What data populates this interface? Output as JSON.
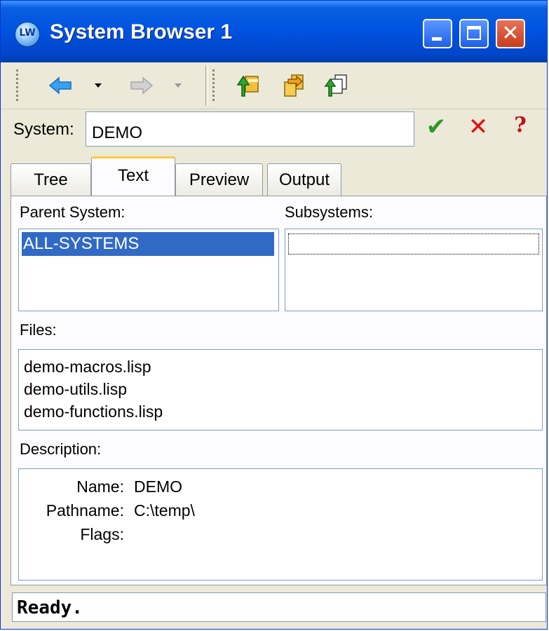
{
  "window": {
    "title": "System Browser 1",
    "icon_text": "LW"
  },
  "toolbar": {
    "items": [
      "back-arrow-icon",
      "forward-arrow-icon",
      "system-up-icon",
      "system-open-icon",
      "system-copy-icon"
    ]
  },
  "system": {
    "label": "System:",
    "value": "DEMO"
  },
  "actions": {
    "accept": "✔",
    "cancel": "✕",
    "help": "?"
  },
  "tabs": [
    {
      "label": "Tree",
      "active": false
    },
    {
      "label": "Text",
      "active": true
    },
    {
      "label": "Preview",
      "active": false
    },
    {
      "label": "Output",
      "active": false
    }
  ],
  "parent_system": {
    "label": "Parent System:",
    "items": [
      "ALL-SYSTEMS"
    ],
    "selected": "ALL-SYSTEMS"
  },
  "subsystems": {
    "label": "Subsystems:",
    "items": []
  },
  "files": {
    "label": "Files:",
    "items": [
      "demo-macros.lisp",
      "demo-utils.lisp",
      "demo-functions.lisp"
    ]
  },
  "description": {
    "label": "Description:",
    "rows": [
      {
        "key": "Name:",
        "value": "DEMO"
      },
      {
        "key": "Pathname:",
        "value": "C:\\temp\\"
      },
      {
        "key": "Flags:",
        "value": ""
      }
    ]
  },
  "status": {
    "text": "Ready."
  },
  "colors": {
    "titlebar": "#0052e0",
    "selection": "#316ac5",
    "tab_highlight": "#ffc83c",
    "face": "#ece9d8"
  }
}
